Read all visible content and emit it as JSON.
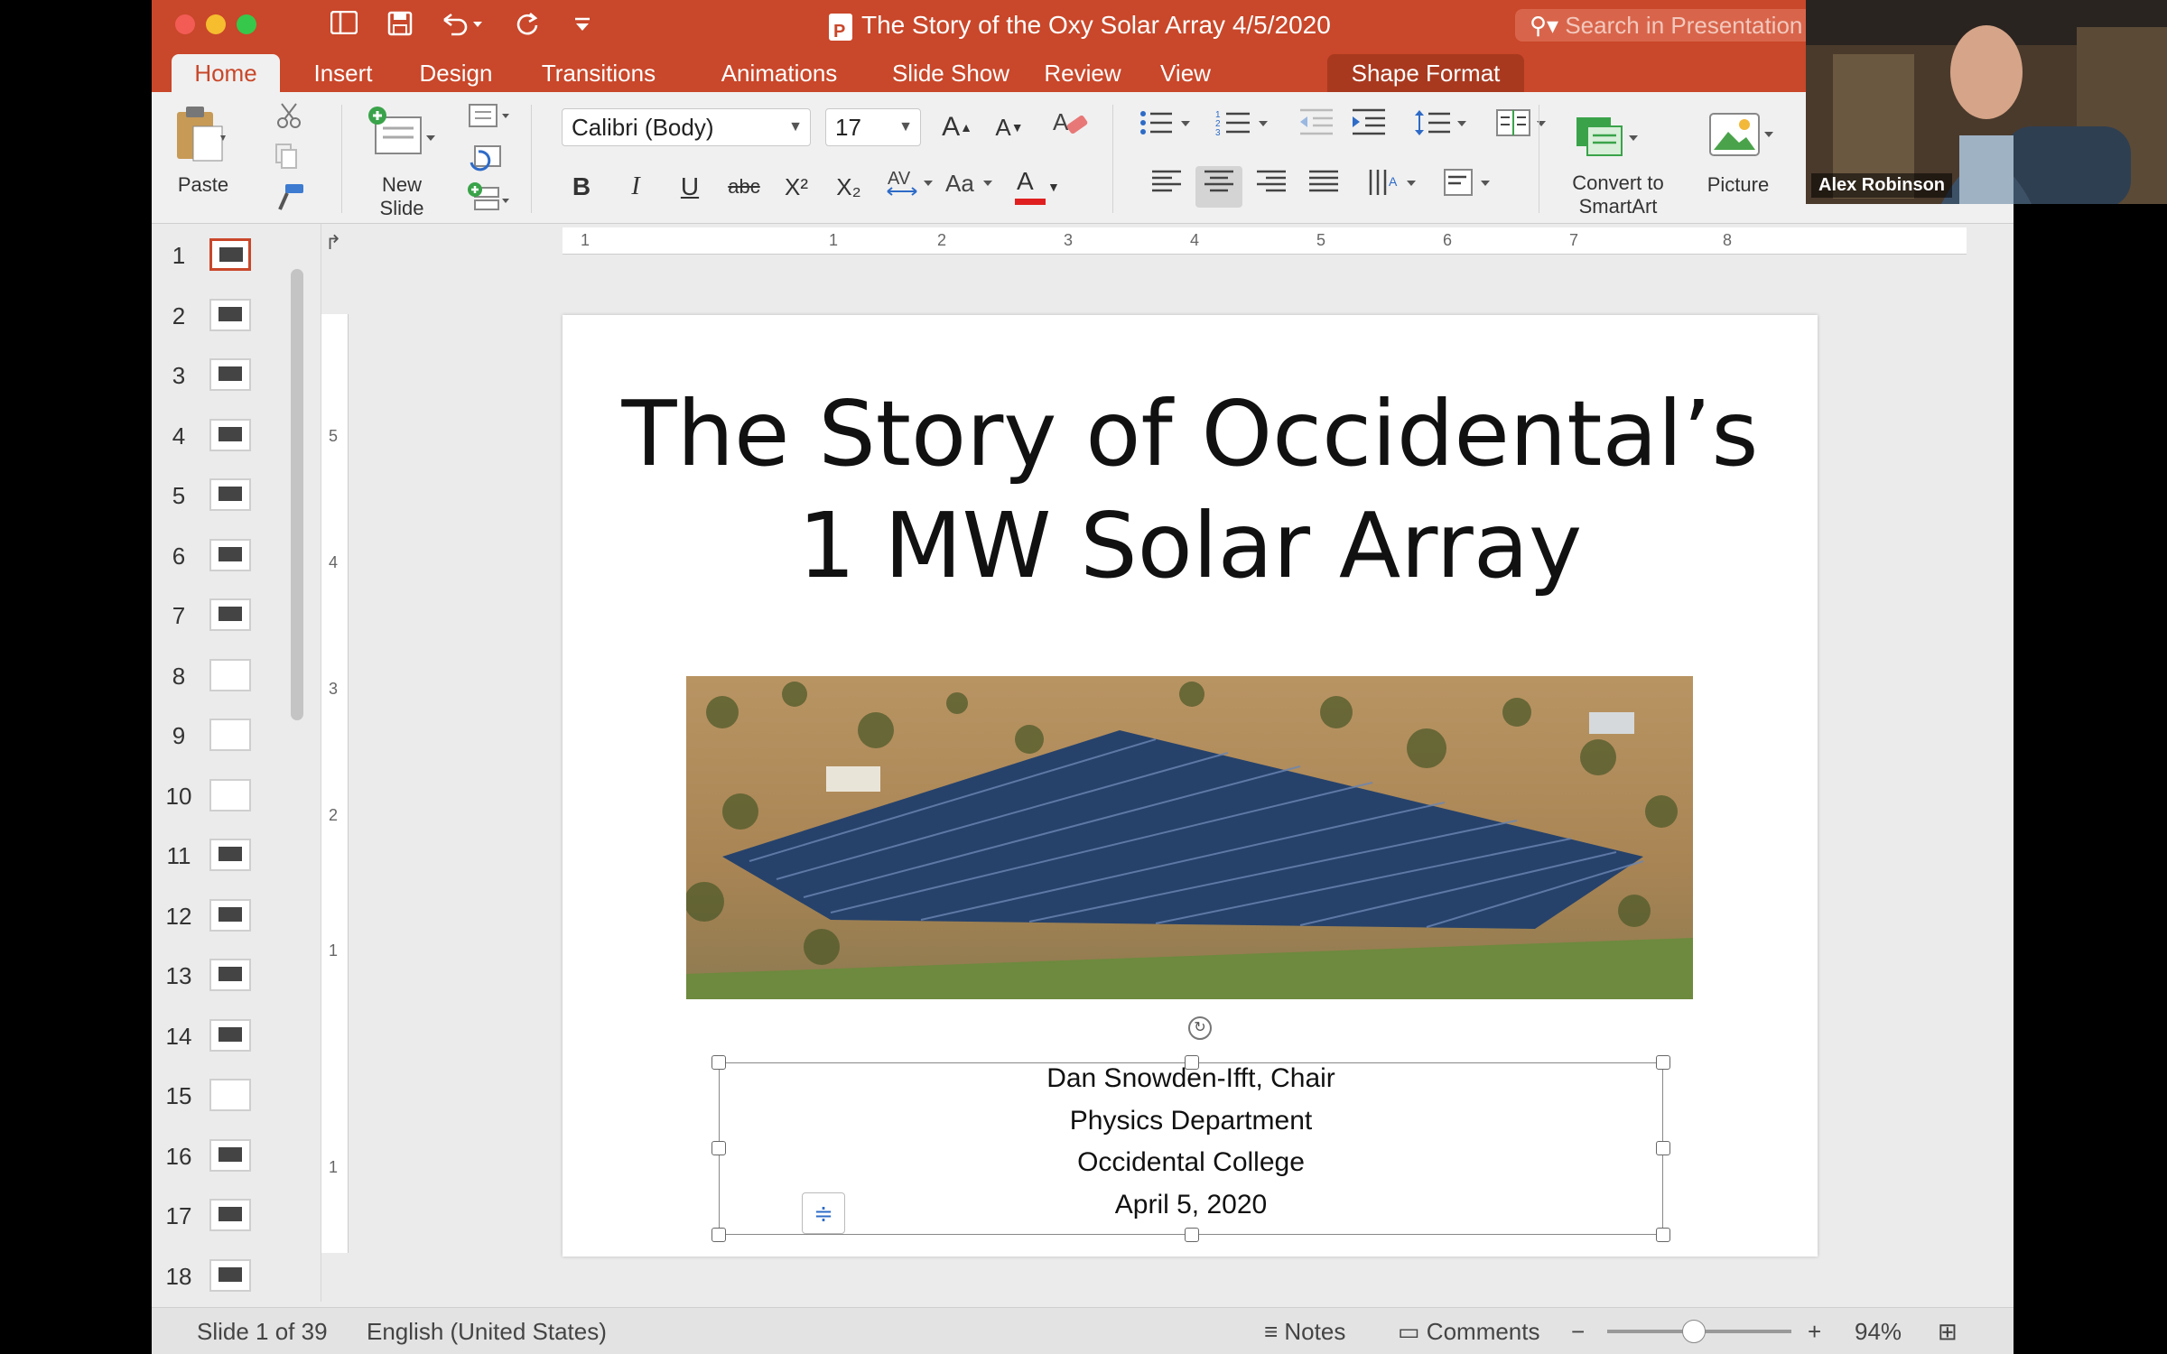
{
  "titlebar": {
    "document_title": "The Story of the Oxy Solar Array 4/5/2020",
    "search_placeholder": "Search in Presentation"
  },
  "tabs": [
    {
      "label": "Home",
      "active": true
    },
    {
      "label": "Insert"
    },
    {
      "label": "Design"
    },
    {
      "label": "Transitions"
    },
    {
      "label": "Animations"
    },
    {
      "label": "Slide Show"
    },
    {
      "label": "Review"
    },
    {
      "label": "View"
    },
    {
      "label": "Shape Format"
    }
  ],
  "ribbon": {
    "paste_label": "Paste",
    "new_slide_label": "New\nSlide",
    "font_name": "Calibri (Body)",
    "font_size": "17",
    "convert_smartart_label": "Convert to\nSmartArt",
    "picture_label": "Picture",
    "bold": "B",
    "italic": "I",
    "underline": "U",
    "strikethrough": "abc",
    "superscript": "X²",
    "subscript": "X₂",
    "font_color_letter": "A",
    "font_color": "#e02020"
  },
  "thumbnails": [
    "1",
    "2",
    "3",
    "4",
    "5",
    "6",
    "7",
    "8",
    "9",
    "10",
    "11",
    "12",
    "13",
    "14",
    "15",
    "16",
    "17",
    "18"
  ],
  "selected_slide": 1,
  "ruler": {
    "h": [
      "1",
      "1",
      "2",
      "3",
      "4",
      "5",
      "6",
      "7",
      "8"
    ],
    "v": [
      "5",
      "4",
      "3",
      "2",
      "1",
      "1"
    ]
  },
  "slide": {
    "title_line1": "The Story of Occidental’s",
    "title_line2": "1 MW Solar Array",
    "subtitle": [
      "Dan Snowden-Ifft, Chair",
      "Physics Department",
      "Occidental College",
      "April 5, 2020"
    ]
  },
  "statusbar": {
    "slide_counter": "Slide 1 of 39",
    "language": "English (United States)",
    "notes_label": "Notes",
    "comments_label": "Comments",
    "zoom_minus": "−",
    "zoom_plus": "+",
    "zoom_level": "94%",
    "zoom_fraction": 0.47
  },
  "video": {
    "participant_name": "Alex Robinson"
  },
  "colors": {
    "accent": "#c9472a",
    "tab_highlight": "#a8391f"
  }
}
